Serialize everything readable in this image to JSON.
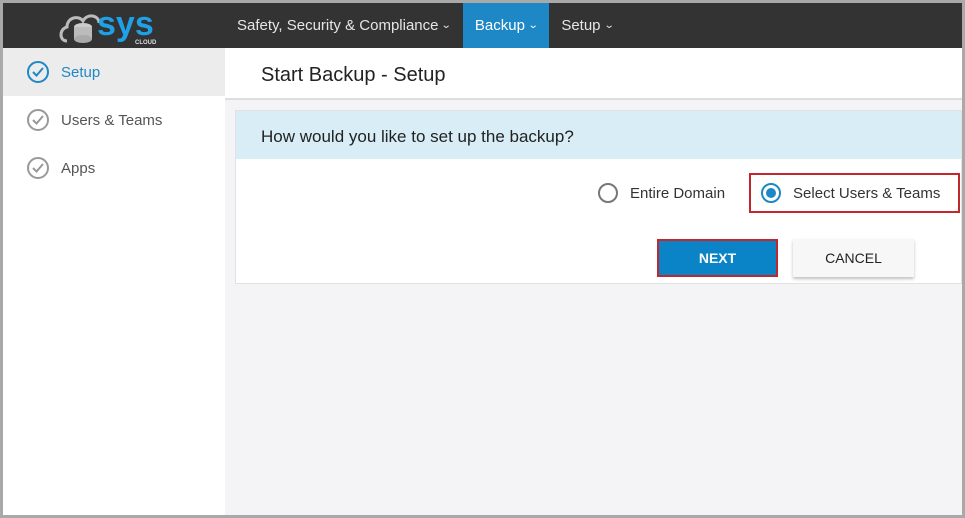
{
  "brand": {
    "logo_text": "sys",
    "logo_sub": "CLOUD"
  },
  "nav": [
    {
      "label": "Safety, Security & Compliance"
    },
    {
      "label": "Backup"
    },
    {
      "label": "Setup"
    }
  ],
  "sidebar": [
    {
      "label": "Setup"
    },
    {
      "label": "Users & Teams"
    },
    {
      "label": "Apps"
    }
  ],
  "page": {
    "title": "Start Backup - Setup",
    "question": "How would you like to set up the backup?",
    "options": [
      {
        "label": "Entire Domain",
        "selected": false
      },
      {
        "label": "Select Users & Teams",
        "selected": true
      }
    ],
    "next_label": "NEXT",
    "cancel_label": "CANCEL"
  },
  "colors": {
    "accent": "#1e88c7",
    "highlight": "#c1272d",
    "topbar": "#333333"
  }
}
